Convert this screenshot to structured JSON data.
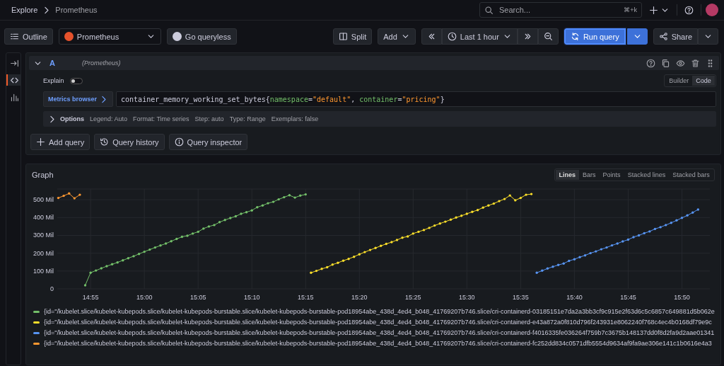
{
  "breadcrumbs": [
    {
      "label": "Explore"
    },
    {
      "label": "Prometheus"
    }
  ],
  "search": {
    "placeholder": "Search...",
    "shortcut": "⌘+k"
  },
  "toolbar": {
    "outline": "Outline",
    "datasource": "Prometheus",
    "queryless": "Go queryless",
    "split": "Split",
    "add": "Add",
    "time_range": "Last 1 hour",
    "run": "Run query",
    "share": "Share"
  },
  "sidebar_items": [
    {
      "kind": "collapse",
      "selected": false
    },
    {
      "kind": "code",
      "selected": true
    },
    {
      "kind": "chart",
      "selected": false
    }
  ],
  "query": {
    "letter": "A",
    "datasource": "(Prometheus)",
    "explain": {
      "label": "Explain",
      "on": false
    },
    "modes": [
      {
        "label": "Builder",
        "selected": false
      },
      {
        "label": "Code",
        "selected": true
      }
    ],
    "metrics_browser": "Metrics browser",
    "expression": [
      {
        "kind": "metric",
        "text": "container_memory_working_set_bytes"
      },
      {
        "kind": "punct",
        "text": "{"
      },
      {
        "kind": "label",
        "text": "namespace"
      },
      {
        "kind": "punct",
        "text": "="
      },
      {
        "kind": "string",
        "text": "\"default\""
      },
      {
        "kind": "punct",
        "text": ", "
      },
      {
        "kind": "label",
        "text": "container"
      },
      {
        "kind": "punct",
        "text": "="
      },
      {
        "kind": "string",
        "text": "\"pricing\""
      },
      {
        "kind": "punct",
        "text": "}"
      }
    ],
    "options": {
      "label": "Options",
      "expanded": false,
      "items": [
        "Legend: Auto",
        "Format: Time series",
        "Step: auto",
        "Type: Range",
        "Exemplars: false"
      ]
    }
  },
  "actions": [
    {
      "kind": "add",
      "label": "Add query"
    },
    {
      "kind": "history",
      "label": "Query history"
    },
    {
      "kind": "info",
      "label": "Query inspector"
    }
  ],
  "graph": {
    "title": "Graph",
    "styles": [
      {
        "label": "Lines",
        "selected": true
      },
      {
        "label": "Bars",
        "selected": false
      },
      {
        "label": "Points",
        "selected": false
      },
      {
        "label": "Stacked lines",
        "selected": false
      },
      {
        "label": "Stacked bars",
        "selected": false
      }
    ],
    "chart_data": {
      "type": "line",
      "grid": true,
      "xlim": [
        891.9,
        952.6
      ],
      "ylim": [
        0,
        560
      ],
      "xticks": [
        {
          "value": 895,
          "label": "14:55"
        },
        {
          "value": 900,
          "label": "15:00"
        },
        {
          "value": 905,
          "label": "15:05"
        },
        {
          "value": 910,
          "label": "15:10"
        },
        {
          "value": 915,
          "label": "15:15"
        },
        {
          "value": 920,
          "label": "15:20"
        },
        {
          "value": 925,
          "label": "15:25"
        },
        {
          "value": 930,
          "label": "15:30"
        },
        {
          "value": 935,
          "label": "15:35"
        },
        {
          "value": 940,
          "label": "15:40"
        },
        {
          "value": 945,
          "label": "15:45"
        },
        {
          "value": 950,
          "label": "15:50"
        }
      ],
      "yticks": [
        {
          "value": 0,
          "label": "0"
        },
        {
          "value": 100,
          "label": "100 Mil"
        },
        {
          "value": 200,
          "label": "200 Mil"
        },
        {
          "value": 300,
          "label": "300 Mil"
        },
        {
          "value": 400,
          "label": "400 Mil"
        },
        {
          "value": 500,
          "label": "500 Mil"
        }
      ],
      "x": [
        892,
        892.5,
        893,
        893.5,
        894,
        894.5,
        895,
        895.5,
        896,
        896.5,
        897,
        897.5,
        898,
        898.5,
        899,
        899.5,
        900,
        900.5,
        901,
        901.5,
        902,
        902.5,
        903,
        903.5,
        904,
        904.5,
        905,
        905.5,
        906,
        906.5,
        907,
        907.5,
        908,
        908.5,
        909,
        909.5,
        910,
        910.5,
        911,
        911.5,
        912,
        912.5,
        913,
        913.5,
        914,
        914.5,
        915,
        915.5,
        916,
        916.5,
        917,
        917.5,
        918,
        918.5,
        919,
        919.5,
        920,
        920.5,
        921,
        921.5,
        922,
        922.5,
        923,
        923.5,
        924,
        924.5,
        925,
        925.5,
        926,
        926.5,
        927,
        927.5,
        928,
        928.5,
        929,
        929.5,
        930,
        930.5,
        931,
        931.5,
        932,
        932.5,
        933,
        933.5,
        934,
        934.5,
        935,
        935.5,
        936,
        936.5,
        937,
        937.5,
        938,
        938.5,
        939,
        939.5,
        940,
        940.5,
        941,
        941.5,
        942,
        942.5,
        943,
        943.5,
        944,
        944.5,
        945,
        945.5,
        946,
        946.5,
        947,
        947.5,
        948,
        948.5,
        949,
        949.5,
        950,
        950.5,
        951,
        951.5
      ],
      "series": [
        {
          "color": "#73bf69",
          "values": [
            null,
            null,
            null,
            null,
            null,
            20,
            90,
            103,
            115,
            127,
            138,
            148,
            160,
            172,
            183,
            196,
            208,
            220,
            232,
            243,
            254,
            267,
            280,
            292,
            298,
            310,
            320,
            338,
            350,
            358,
            374,
            386,
            397,
            407,
            421,
            430,
            440,
            458,
            468,
            480,
            488,
            502,
            514,
            525,
            512,
            523,
            530,
            null,
            null,
            null,
            null,
            null,
            null,
            null,
            null,
            null,
            null,
            null,
            null,
            null,
            null,
            null,
            null,
            null,
            null,
            null,
            null,
            null,
            null,
            null,
            null,
            null,
            null,
            null,
            null,
            null,
            null,
            null,
            null,
            null,
            null,
            null,
            null,
            null,
            null,
            null,
            null,
            null,
            null,
            null,
            null,
            null,
            null,
            null,
            null,
            null,
            null,
            null,
            null,
            null,
            null,
            null,
            null,
            null,
            null,
            null,
            null,
            null,
            null,
            null,
            null,
            null,
            null,
            null,
            null,
            null,
            null,
            null,
            null,
            null
          ]
        },
        {
          "color": "#fade2a",
          "values": [
            null,
            null,
            null,
            null,
            null,
            null,
            null,
            null,
            null,
            null,
            null,
            null,
            null,
            null,
            null,
            null,
            null,
            null,
            null,
            null,
            null,
            null,
            null,
            null,
            null,
            null,
            null,
            null,
            null,
            null,
            null,
            null,
            null,
            null,
            null,
            null,
            null,
            null,
            null,
            null,
            null,
            null,
            null,
            null,
            null,
            null,
            null,
            90,
            101,
            112,
            121,
            136,
            146,
            158,
            168,
            180,
            194,
            206,
            218,
            229,
            241,
            252,
            262,
            274,
            287,
            294,
            310,
            320,
            330,
            342,
            355,
            366,
            377,
            388,
            400,
            410,
            421,
            432,
            442,
            456,
            468,
            478,
            492,
            504,
            524,
            497,
            510,
            528,
            532,
            null,
            null,
            null,
            null,
            null,
            null,
            null,
            null,
            null,
            null,
            null,
            null,
            null,
            null,
            null,
            null,
            null,
            null,
            null,
            null,
            null,
            null,
            null,
            null,
            null,
            null,
            null,
            null,
            null,
            null,
            null
          ]
        },
        {
          "color": "#5794f2",
          "values": [
            null,
            null,
            null,
            null,
            null,
            null,
            null,
            null,
            null,
            null,
            null,
            null,
            null,
            null,
            null,
            null,
            null,
            null,
            null,
            null,
            null,
            null,
            null,
            null,
            null,
            null,
            null,
            null,
            null,
            null,
            null,
            null,
            null,
            null,
            null,
            null,
            null,
            null,
            null,
            null,
            null,
            null,
            null,
            null,
            null,
            null,
            null,
            null,
            null,
            null,
            null,
            null,
            null,
            null,
            null,
            null,
            null,
            null,
            null,
            null,
            null,
            null,
            null,
            null,
            null,
            null,
            null,
            null,
            null,
            null,
            null,
            null,
            null,
            null,
            null,
            null,
            null,
            null,
            null,
            null,
            null,
            null,
            null,
            null,
            null,
            null,
            null,
            null,
            null,
            90,
            102,
            114,
            124,
            134,
            142,
            157,
            166,
            178,
            188,
            200,
            210,
            222,
            232,
            244,
            254,
            266,
            276,
            290,
            300,
            312,
            322,
            336,
            346,
            358,
            370,
            384,
            398,
            412,
            428,
            445
          ]
        },
        {
          "color": "#ff9830",
          "values": [
            510,
            522,
            535,
            508,
            528,
            null,
            null,
            null,
            null,
            null,
            null,
            null,
            null,
            null,
            null,
            null,
            null,
            null,
            null,
            null,
            null,
            null,
            null,
            null,
            null,
            null,
            null,
            null,
            null,
            null,
            null,
            null,
            null,
            null,
            null,
            null,
            null,
            null,
            null,
            null,
            null,
            null,
            null,
            null,
            null,
            null,
            null,
            null,
            null,
            null,
            null,
            null,
            null,
            null,
            null,
            null,
            null,
            null,
            null,
            null,
            null,
            null,
            null,
            null,
            null,
            null,
            null,
            null,
            null,
            null,
            null,
            null,
            null,
            null,
            null,
            null,
            null,
            null,
            null,
            null,
            null,
            null,
            null,
            null,
            null,
            null,
            null,
            null,
            null,
            null,
            null,
            null,
            null,
            null,
            null,
            null,
            null,
            null,
            null,
            null,
            null,
            null,
            null,
            null,
            null,
            null,
            null,
            null,
            null,
            null,
            null,
            null,
            null,
            null,
            null,
            null,
            null,
            null,
            null,
            null
          ]
        }
      ]
    },
    "legend": [
      {
        "color": "#73bf69",
        "label": "{id=\"/kubelet.slice/kubelet-kubepods.slice/kubelet-kubepods-burstable.slice/kubelet-kubepods-burstable-pod18954abe_438d_4ed4_b048_41769207b746.slice/cri-containerd-03185151e7da2a3bb3cf9c915e2f63d6c5c6857c649881d5b062e"
      },
      {
        "color": "#fade2a",
        "label": "{id=\"/kubelet.slice/kubelet-kubepods.slice/kubelet-kubepods-burstable.slice/kubelet-kubepods-burstable-pod18954abe_438d_4ed4_b048_41769207b746.slice/cri-containerd-e43a872a0f810d796f243931e8062240f768c4ec4b0168df79e9c"
      },
      {
        "color": "#5794f2",
        "label": "{id=\"/kubelet.slice/kubelet-kubepods.slice/kubelet-kubepods-burstable.slice/kubelet-kubepods-burstable-pod18954abe_438d_4ed4_b048_41769207b746.slice/cri-containerd-f4016335fe036264f759b7c3675b148137dd0f8d2fa9d2aae01341"
      },
      {
        "color": "#ff9830",
        "label": "{id=\"/kubelet.slice/kubelet-kubepods.slice/kubelet-kubepods-burstable.slice/kubelet-kubepods-burstable-pod18954abe_438d_4ed4_b048_41769207b746.slice/cri-containerd-fc252dd834c0571dfb5554d9634af9fa9ae306e141c1b0616e4a3"
      }
    ]
  }
}
